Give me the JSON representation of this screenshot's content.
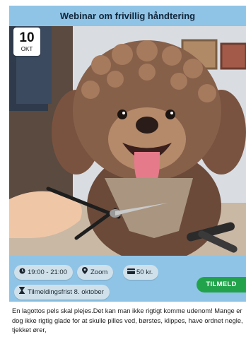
{
  "event": {
    "title": "Webinar om frivillig håndtering",
    "date": {
      "day": "10",
      "month": "OKT"
    },
    "time": "19:00 - 21:00",
    "location": "Zoom",
    "price": "50 kr.",
    "deadline": "Tilmeldingsfrist 8. oktober",
    "signup_label": "TILMELD",
    "description": "En lagottos pels skal plejes.Det kan man ikke rigtigt komme udenom! Mange er dog ikke rigtig glade for at skulle pilles ved, børstes, klippes, have ordnet negle, tjekket ører,"
  },
  "icons": {
    "time": "clock-icon",
    "location": "map-pin-icon",
    "price": "money-icon",
    "deadline": "hourglass-icon"
  },
  "colors": {
    "card_background": "#8fc4e6",
    "signup_button": "#22a34b",
    "chip_background": "#cfe0ea"
  }
}
